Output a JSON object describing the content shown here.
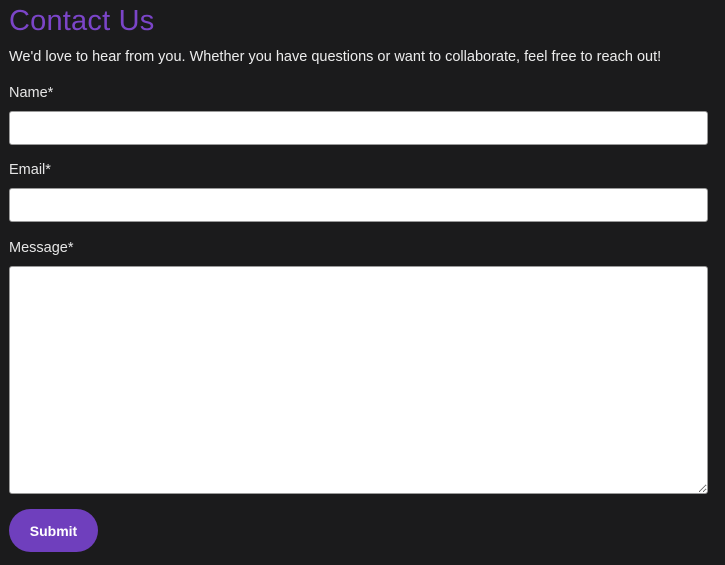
{
  "page": {
    "title": "Contact Us",
    "intro": "We'd love to hear from you. Whether you have questions or want to collaborate, feel free to reach out!"
  },
  "form": {
    "name": {
      "label": "Name*",
      "value": "",
      "placeholder": ""
    },
    "email": {
      "label": "Email*",
      "value": "",
      "placeholder": ""
    },
    "message": {
      "label": "Message*",
      "value": "",
      "placeholder": ""
    },
    "submit_label": "Submit"
  },
  "colors": {
    "background": "#1b1b1c",
    "accent": "#7b45c8",
    "button": "#6f3fbd",
    "text": "#ececec",
    "input_background": "#ffffff"
  }
}
